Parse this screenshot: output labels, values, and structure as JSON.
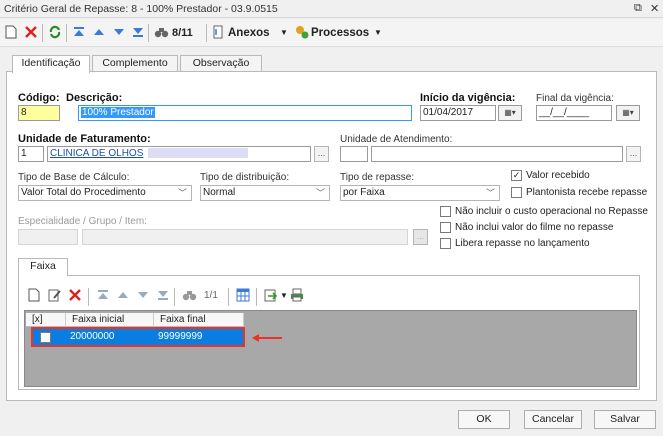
{
  "window": {
    "title": "Critério Geral de Repasse: 8 - 100% Prestador - 03.9.0515",
    "restore_glyph": "⧉",
    "close_glyph": "✕"
  },
  "toolbar": {
    "record_counter": "8/11",
    "anexos_label": "Anexos",
    "processos_label": "Processos",
    "icons": [
      "new-icon",
      "delete-icon",
      "refresh-icon",
      "first-icon",
      "previous-icon",
      "next-icon",
      "last-icon",
      "search-icon",
      "attachment-icon",
      "process-icon"
    ]
  },
  "tabs": [
    {
      "label": "Identificação",
      "active": true
    },
    {
      "label": "Complemento",
      "active": false
    },
    {
      "label": "Observação",
      "active": false
    }
  ],
  "form": {
    "codigo_label": "Código:",
    "codigo_value": "8",
    "descricao_label": "Descrição:",
    "descricao_value": "100% Prestador",
    "inicio_label": "Início da vigência:",
    "inicio_value": "01/04/2017",
    "final_label": "Final da vigência:",
    "final_value": "__/__/____",
    "unidade_fat_label": "Unidade de Faturamento:",
    "unidade_fat_code": "1",
    "unidade_fat_name": "CLINICA DE OLHOS",
    "unidade_at_label": "Unidade de Atendimento:",
    "unidade_at_code": "",
    "unidade_at_name": "",
    "tipo_base_label": "Tipo de Base de Cálculo:",
    "tipo_base_value": "Valor Total do Procedimento",
    "tipo_dist_label": "Tipo de distribuição:",
    "tipo_dist_value": "Normal",
    "tipo_rep_label": "Tipo de repasse:",
    "tipo_rep_value": "por Faixa",
    "especialidade_label": "Especialidade / Grupo / Item:",
    "lookup_btn": "..."
  },
  "checkboxes": [
    {
      "label": "Valor recebido",
      "checked": true
    },
    {
      "label": "Plantonista recebe repasse",
      "checked": false
    },
    {
      "label": "Não incluir o custo operacional no Repasse",
      "checked": false
    },
    {
      "label": "Não inclui valor do filme no repasse",
      "checked": false
    },
    {
      "label": "Libera repasse no lançamento",
      "checked": false
    }
  ],
  "faixa": {
    "tab_label": "Faixa",
    "counter": "1/1",
    "columns": [
      "[x]",
      "Faixa inicial",
      "Faixa final"
    ],
    "rows": [
      {
        "selected": false,
        "inicial": "20000000",
        "final": "99999999"
      }
    ],
    "arrow_color": "#e8332a"
  },
  "buttons": {
    "ok": "OK",
    "cancel": "Cancelar",
    "save": "Salvar"
  }
}
